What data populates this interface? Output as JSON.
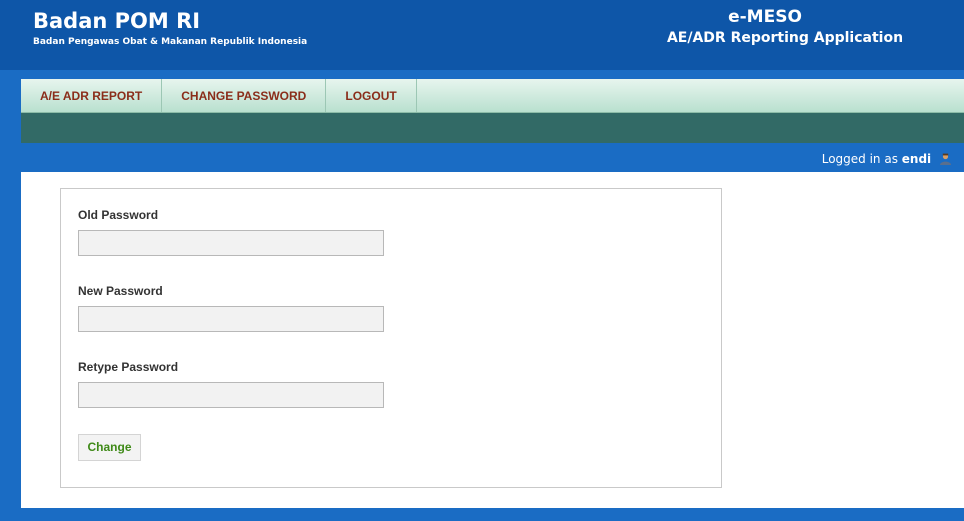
{
  "header": {
    "org_title": "Badan POM RI",
    "org_subtitle": "Badan Pengawas Obat & Makanan Republik Indonesia",
    "app_title": "e-MESO",
    "app_subtitle": "AE/ADR Reporting Application"
  },
  "nav": {
    "items": [
      {
        "label": "A/E ADR REPORT"
      },
      {
        "label": "CHANGE PASSWORD"
      },
      {
        "label": "LOGOUT"
      }
    ]
  },
  "status": {
    "logged_in_prefix": "Logged in as",
    "username": "endi",
    "user_icon": "user-icon"
  },
  "form": {
    "old_password_label": "Old Password",
    "old_password_value": "",
    "new_password_label": "New Password",
    "new_password_value": "",
    "retype_password_label": "Retype Password",
    "retype_password_value": "",
    "submit_label": "Change"
  },
  "colors": {
    "header_bg": "#0e56a8",
    "page_bg": "#1a6cc4",
    "nav_text": "#8a2d1a",
    "subbar_bg": "#326a66",
    "button_text": "#3f8a18"
  }
}
